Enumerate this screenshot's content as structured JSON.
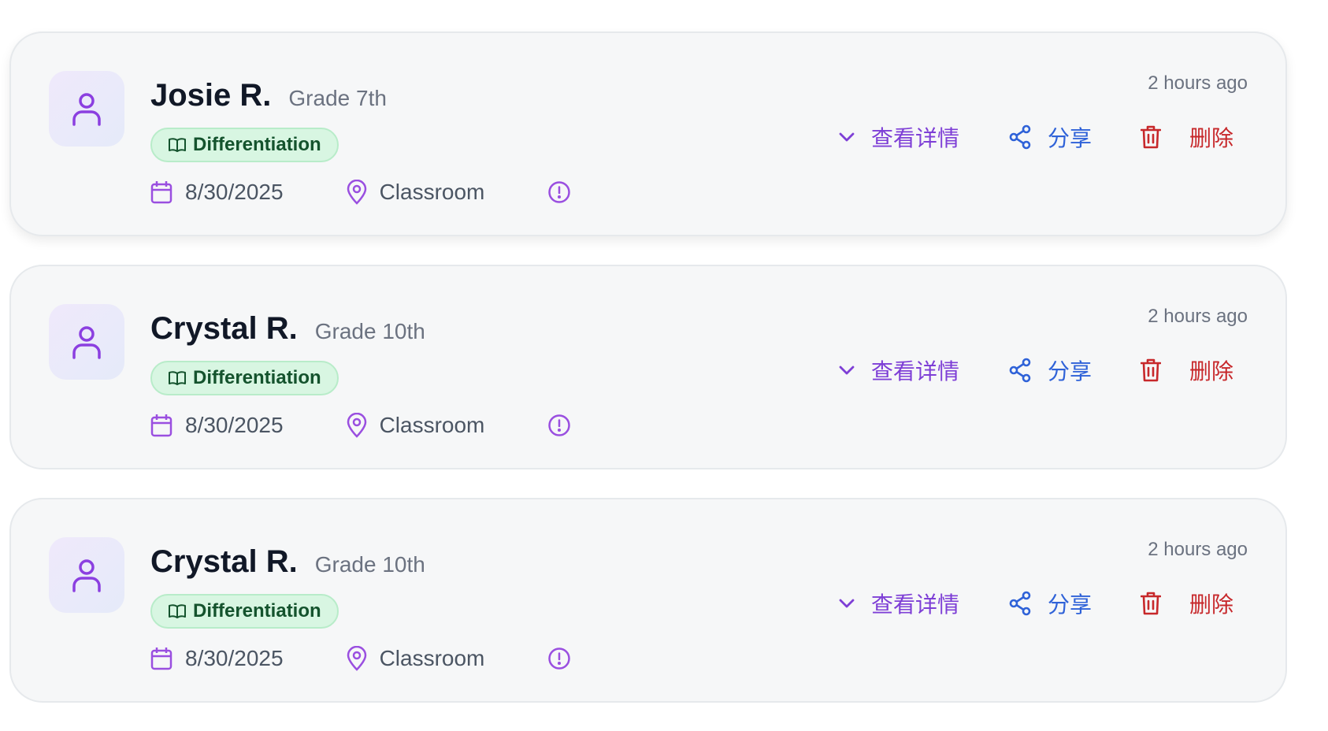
{
  "colors": {
    "purple": "#9a4fe0",
    "blue": "#2f62d8",
    "red": "#c7282b",
    "tag_text": "#14532d"
  },
  "cards": [
    {
      "name": "Josie R.",
      "grade": "Grade 7th",
      "tag": "Differentiation",
      "date": "8/30/2025",
      "location": "Classroom",
      "time": "2 hours ago",
      "actions": {
        "view": "查看详情",
        "share": "分享",
        "delete": "删除"
      }
    },
    {
      "name": "Crystal R.",
      "grade": "Grade 10th",
      "tag": "Differentiation",
      "date": "8/30/2025",
      "location": "Classroom",
      "time": "2 hours ago",
      "actions": {
        "view": "查看详情",
        "share": "分享",
        "delete": "删除"
      }
    },
    {
      "name": "Crystal R.",
      "grade": "Grade 10th",
      "tag": "Differentiation",
      "date": "8/30/2025",
      "location": "Classroom",
      "time": "2 hours ago",
      "actions": {
        "view": "查看详情",
        "share": "分享",
        "delete": "删除"
      }
    }
  ]
}
